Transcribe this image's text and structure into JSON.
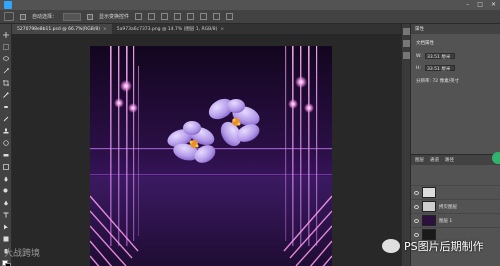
{
  "menubar": {
    "window_controls": [
      "–",
      "□",
      "✕"
    ]
  },
  "options_bar": {
    "auto_select_label": "自动选择：",
    "show_transform_label": "显示变换控件"
  },
  "tabs": [
    {
      "label": "5270798e8b11.psd @ 66.7%(RGB/8)",
      "active": true
    },
    {
      "label": "5a973a6c7373.png @ 14.7% (图层 1, RGB/8)",
      "active": false
    }
  ],
  "properties": {
    "title": "属性",
    "subtitle": "文档属性",
    "w_label": "W:",
    "w_value": "33.51 厘米",
    "h_label": "H:",
    "h_value": "33.51 厘米",
    "res_label": "分辨率: 72 像素/英寸"
  },
  "layers": {
    "tabs": [
      "图层",
      "通道",
      "路径"
    ],
    "rows": [
      {
        "name": "",
        "thumb": "#dcdcdc"
      },
      {
        "name": "拷贝图层",
        "thumb": "#cfcfcf"
      },
      {
        "name": "图层 1",
        "thumb": "#2b1040"
      },
      {
        "name": "",
        "thumb": "#1a1a1a"
      }
    ]
  },
  "watermark_left": "大战跨境",
  "watermark_right": "PS图片后期制作",
  "colors": {
    "accent": "#31a8ff",
    "canvas_bg": "#1c0a2e",
    "flower": "#b79be8",
    "flower_center": "#e8902a",
    "glow": "#ff9cf2"
  },
  "icons": [
    "ps-logo-icon",
    "move-tool-icon",
    "marquee-tool-icon",
    "lasso-tool-icon",
    "crop-tool-icon",
    "eyedropper-icon",
    "brush-icon",
    "eraser-icon",
    "type-tool-icon",
    "zoom-icon",
    "eye-icon"
  ]
}
